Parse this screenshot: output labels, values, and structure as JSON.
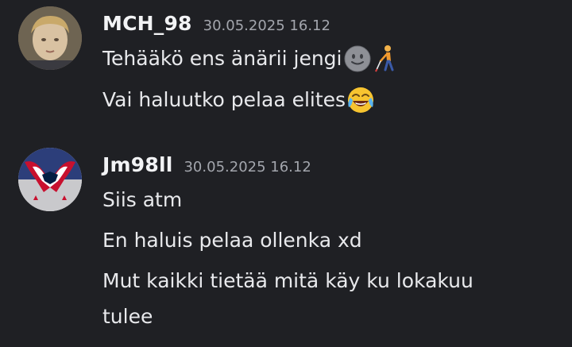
{
  "messages": [
    {
      "author": "MCH_98",
      "timestamp": "30.05.2025 16.12",
      "avatar_icon": "child-photo-avatar",
      "lines": [
        {
          "text": "Tehääkö ens änärii jengi",
          "emojis": [
            "slightly-smiling-face-icon",
            "person-with-white-cane-icon"
          ]
        },
        {
          "text": "Vai haluutko pelaa elites",
          "emojis": [
            "face-with-tears-of-joy-icon"
          ]
        }
      ]
    },
    {
      "author": "Jm98ll",
      "timestamp": "30.05.2025 16.12",
      "avatar_icon": "capitals-eagle-logo-avatar",
      "lines": [
        {
          "text": "Siis atm"
        },
        {
          "text": "En haluis pelaa ollenka xd"
        },
        {
          "text": "Mut kaikki tietää mitä käy ku lokakuu"
        },
        {
          "text": "tulee"
        }
      ]
    }
  ],
  "colors": {
    "background": "#1f2024",
    "username": "#f2f3f5",
    "timestamp": "#a3a6ad",
    "message_text": "#e8e9ec"
  }
}
